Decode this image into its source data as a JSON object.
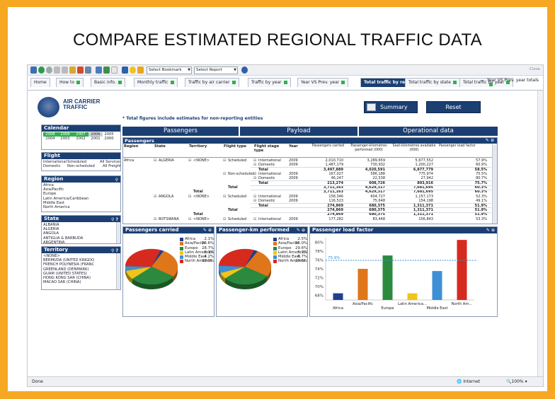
{
  "slide": {
    "title": "COMPARE ESTIMATED REGIONAL TRAFFIC DATA"
  },
  "toolbar": {
    "bookmark_select": "Select Bookmark",
    "report_select": "Select Report",
    "close_label": "Close"
  },
  "tabs": [
    {
      "label": "Home",
      "dot": false
    },
    {
      "label": "How to",
      "dot": true
    },
    {
      "label": "Basic info.",
      "dot": true
    },
    {
      "label": "Monthly traffic",
      "dot": true
    },
    {
      "label": "Traffic by air carrier",
      "dot": true
    },
    {
      "label": "Traffic by year",
      "dot": true
    },
    {
      "label": "Year VS Prev. year",
      "dot": true
    },
    {
      "label": "Total traffic by region",
      "dot": true,
      "active": true
    },
    {
      "label": "Total traffic by state",
      "dot": true
    },
    {
      "label": "Total traffic by year",
      "dot": true
    },
    {
      "label": "Year VS Prev. year totals",
      "dot": true
    }
  ],
  "header": {
    "logo_line1": "AIR CARRIER",
    "logo_line2": "TRAFFIC",
    "summary_label": "Summary",
    "reset_label": "Reset",
    "note": "* Total figures include estimates for non-reporting entities"
  },
  "calendar": {
    "title": "Calendar",
    "years": [
      [
        "2008",
        "2008",
        "2007",
        "2006"
      ],
      [
        "2005",
        "2004",
        "2003",
        "2002"
      ],
      [
        "2001",
        "2000",
        "",
        ""
      ]
    ]
  },
  "flight": {
    "title": "Flight",
    "rows": [
      [
        "International",
        "Scheduled",
        "All Services"
      ],
      [
        "Domestic",
        "Non-scheduled",
        "All Freight"
      ]
    ]
  },
  "region": {
    "title": "Region",
    "items": [
      "Africa",
      "Asia/Pacific",
      "Europe",
      "Latin America/Caribbean",
      "Middle East",
      "North America"
    ]
  },
  "state": {
    "title": "State",
    "items": [
      "ALBANIA",
      "ALGERIA",
      "ANGOLA",
      "ANTIGUA & BARBUDA",
      "ARGENTINA"
    ]
  },
  "territory": {
    "title": "Territory",
    "items": [
      "<NONE>",
      "BERMUDA (UNITED KINGDO",
      "FRENCH POLYNESIA (FRANC",
      "GREENLAND (DENMARK)",
      "GUAM (UNITED STATES)",
      "HONG KONG SAR (CHINA)",
      "MACAO SAR (CHINA)"
    ]
  },
  "main_headers": [
    "Passengers",
    "Payload",
    "Operational data"
  ],
  "table": {
    "title": "Passengers",
    "columns": [
      "Region",
      "State",
      "Territory",
      "Flight type",
      "Flight stage type",
      "Year",
      "Passengers carried",
      "Passenger-kilometres performed (000)",
      "Seat-kilometres available (000)",
      "Passenger load factor"
    ],
    "rows": [
      {
        "region": "Africa",
        "state": "ALGERIA",
        "territory": "<NONE>",
        "ftype": "Scheduled",
        "stage": "International",
        "year": "2009",
        "pc": "2,010,710",
        "pkp": "3,289,659",
        "ska": "5,677,552",
        "plf": "57.9%",
        "bold": false
      },
      {
        "region": "",
        "state": "",
        "territory": "",
        "ftype": "",
        "stage": "Domestic",
        "year": "2009",
        "pc": "1,487,179",
        "pkp": "730,932",
        "ska": "1,200,227",
        "plf": "60.9%",
        "bold": false
      },
      {
        "region": "",
        "state": "",
        "territory": "",
        "ftype": "",
        "stage": "Total",
        "year": "",
        "pc": "3,497,889",
        "pkp": "4,020,591",
        "ska": "6,877,779",
        "plf": "58.5%",
        "bold": true
      },
      {
        "region": "",
        "state": "",
        "territory": "",
        "ftype": "Non-scheduled",
        "stage": "International",
        "year": "2009",
        "pc": "167,027",
        "pkp": "586,188",
        "ska": "775,974",
        "plf": "75.5%",
        "bold": false
      },
      {
        "region": "",
        "state": "",
        "territory": "",
        "ftype": "",
        "stage": "Domestic",
        "year": "2009",
        "pc": "46,247",
        "pkp": "22,538",
        "ska": "27,942",
        "plf": "80.7%",
        "bold": false
      },
      {
        "region": "",
        "state": "",
        "territory": "",
        "ftype": "",
        "stage": "Total",
        "year": "",
        "pc": "213,274",
        "pkp": "608,726",
        "ska": "803,916",
        "plf": "75.7%",
        "bold": true
      },
      {
        "region": "",
        "state": "",
        "territory": "",
        "ftype": "Total",
        "stage": "",
        "year": "",
        "pc": "3,711,163",
        "pkp": "4,629,317",
        "ska": "7,681,695",
        "plf": "60.3%",
        "bold": true
      },
      {
        "region": "",
        "state": "",
        "territory": "Total",
        "ftype": "",
        "stage": "",
        "year": "",
        "pc": "3,711,163",
        "pkp": "4,629,317",
        "ska": "7,681,695",
        "plf": "60.3%",
        "bold": true
      },
      {
        "region": "",
        "state": "ANGOLA",
        "territory": "<NONE>",
        "ftype": "Scheduled",
        "stage": "International",
        "year": "2009",
        "pc": "158,346",
        "pkp": "604,727",
        "ska": "1,157,173",
        "plf": "52.3%",
        "bold": false
      },
      {
        "region": "",
        "state": "",
        "territory": "",
        "ftype": "",
        "stage": "Domestic",
        "year": "2009",
        "pc": "116,523",
        "pkp": "75,648",
        "ska": "154,198",
        "plf": "49.1%",
        "bold": false
      },
      {
        "region": "",
        "state": "",
        "territory": "",
        "ftype": "",
        "stage": "Total",
        "year": "",
        "pc": "274,869",
        "pkp": "680,375",
        "ska": "1,311,371",
        "plf": "51.9%",
        "bold": true
      },
      {
        "region": "",
        "state": "",
        "territory": "",
        "ftype": "Total",
        "stage": "",
        "year": "",
        "pc": "274,869",
        "pkp": "680,375",
        "ska": "1,311,371",
        "plf": "51.9%",
        "bold": true
      },
      {
        "region": "",
        "state": "",
        "territory": "Total",
        "ftype": "",
        "stage": "",
        "year": "",
        "pc": "274,869",
        "pkp": "680,375",
        "ska": "1,311,371",
        "plf": "51.9%",
        "bold": true
      },
      {
        "region": "",
        "state": "BOTSWANA",
        "territory": "<NONE>",
        "ftype": "Scheduled",
        "stage": "International",
        "year": "2009",
        "pc": "177,282",
        "pkp": "83,448",
        "ska": "156,843",
        "plf": "53.3%",
        "bold": false
      }
    ]
  },
  "pie_colors": {
    "Africa": "#1f3f8f",
    "Asia/Pacific": "#e0761a",
    "Europe": "#2b8a3e",
    "Latin America/Caribbean": "#f0c419",
    "Middle East": "#3e8fd6",
    "North America": "#d62a1f"
  },
  "chart_data": [
    {
      "type": "pie",
      "title": "Passengers carried",
      "labels": [
        "Africa",
        "Asia/Pacific",
        "Europe",
        "Latin America/C...",
        "Middle East",
        "North America"
      ],
      "values": [
        2.1,
        26.6,
        28.7,
        8.3,
        4.2,
        30.0
      ],
      "display": [
        "2.1%",
        "26.6%",
        "28.7%",
        "8.3%",
        "4.2%",
        "30.0%"
      ]
    },
    {
      "type": "pie",
      "title": "Passenger-km performed",
      "labels": [
        "Africa",
        "Asia/Pacific",
        "Europe",
        "Latin America/C...",
        "Middle East",
        "North America"
      ],
      "values": [
        2.5,
        26.0,
        29.6,
        5.7,
        6.7,
        29.6
      ],
      "display": [
        "2.5%",
        "26.0%",
        "29.6%",
        "5.7%",
        "6.7%",
        "29.6%"
      ]
    },
    {
      "type": "bar",
      "title": "Passenger load factor",
      "categories": [
        "Africa",
        "Asia/Pacific",
        "Europe",
        "Latin America...",
        "Middle East",
        "North Am..."
      ],
      "values": [
        68.5,
        74.0,
        77.0,
        68.5,
        73.5,
        80.5
      ],
      "colors": [
        "#1f3f8f",
        "#e0761a",
        "#2b8a3e",
        "#f0c419",
        "#3e8fd6",
        "#d62a1f"
      ],
      "reference_line": 75.9,
      "reference_label": "75.9%",
      "ylim": [
        67,
        81
      ],
      "yticks": [
        "68%",
        "70%",
        "72%",
        "74%",
        "76%",
        "78%",
        "80%"
      ],
      "ytick_values": [
        68,
        70,
        72,
        74,
        76,
        78,
        80
      ]
    }
  ],
  "status": {
    "left": "Done",
    "zone": "Internet",
    "zoom": "100%"
  }
}
